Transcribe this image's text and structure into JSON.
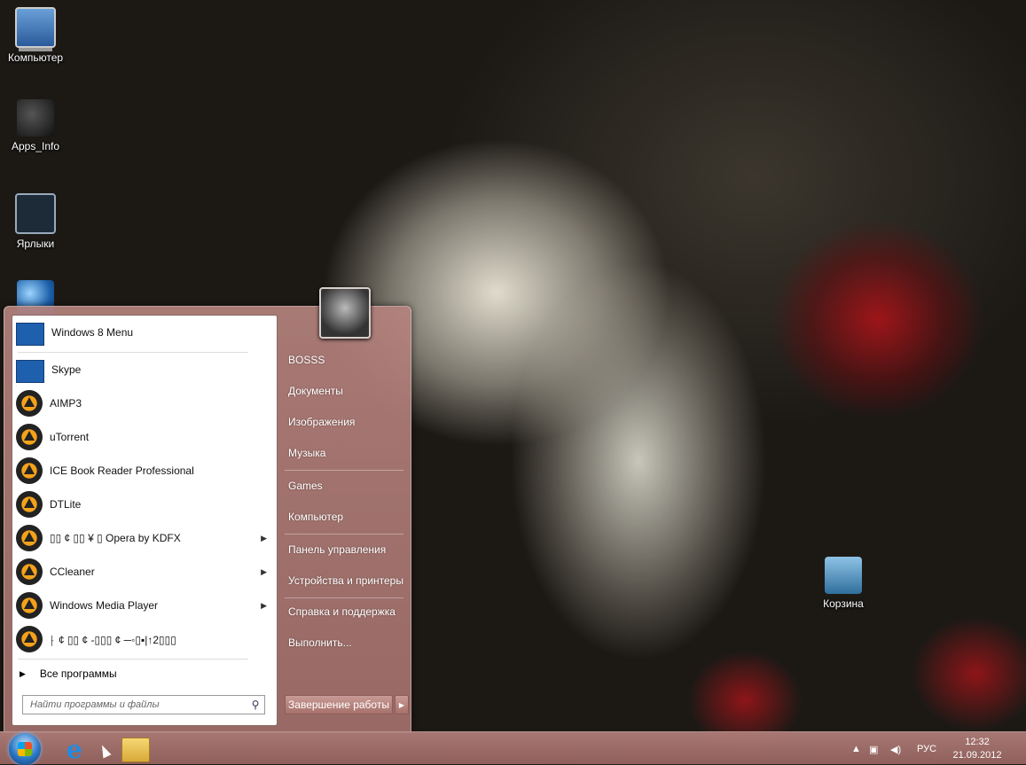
{
  "desktop": {
    "icons": [
      {
        "label": "Компьютер",
        "icon": "computer-icon"
      },
      {
        "label": "Apps_Info",
        "icon": "apps-info-icon"
      },
      {
        "label": "Ярлыки",
        "icon": "shortcuts-icon"
      },
      {
        "label": "",
        "icon": "globe-icon"
      },
      {
        "label": "Корзина",
        "icon": "recycle-bin-icon"
      }
    ]
  },
  "start_menu": {
    "programs": [
      {
        "label": "Windows 8 Menu",
        "icon": "metro-tile-icon",
        "submenu": false
      },
      {
        "label": "Skype",
        "icon": "metro-tile-icon",
        "submenu": false
      },
      {
        "label": "AIMP3",
        "icon": "aimp-icon",
        "submenu": false
      },
      {
        "label": "uTorrent",
        "icon": "aimp-icon",
        "submenu": false
      },
      {
        "label": "ICE Book Reader Professional",
        "icon": "aimp-icon",
        "submenu": false
      },
      {
        "label": "DTLite",
        "icon": "aimp-icon",
        "submenu": false
      },
      {
        "label": "▯▯ ¢ ▯▯ ¥ ▯ Opera by KDFX",
        "icon": "aimp-icon",
        "submenu": true
      },
      {
        "label": "CCleaner",
        "icon": "aimp-icon",
        "submenu": true
      },
      {
        "label": "Windows Media Player",
        "icon": "aimp-icon",
        "submenu": true
      },
      {
        "label": "⸠ ¢ ▯▯ ¢ -▯▯▯ ¢ ─◦▯▪|↑2▯▯▯",
        "icon": "aimp-icon",
        "submenu": false
      }
    ],
    "all_programs": "Все программы",
    "search_placeholder": "Найти программы и файлы",
    "user_name": "BOSSS",
    "places": [
      "Документы",
      "Изображения",
      "Музыка",
      "Games",
      "Компьютер",
      "Панель управления",
      "Устройства и принтеры",
      "Справка и поддержка",
      "Выполнить..."
    ],
    "shutdown_label": "Завершение работы"
  },
  "taskbar": {
    "language": "РУС",
    "time": "12:32",
    "date": "21.09.2012"
  }
}
